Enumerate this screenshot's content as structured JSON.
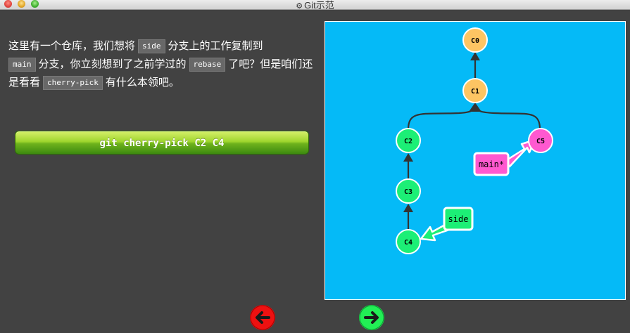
{
  "window": {
    "title": "Git示范",
    "icon": "gear-icon"
  },
  "description": {
    "p1": "这里有一个仓库，我们想将",
    "code_side": "side",
    "p2": "分支上的工作复制到",
    "code_main": "main",
    "p3": "分支，你立刻想到了之前学过的",
    "code_rebase": "rebase",
    "p4": "了吧？但是咱们还是看看",
    "code_cherry": "cherry-pick",
    "p5": "有什么本领吧。"
  },
  "command_button": {
    "label": "git cherry-pick C2 C4"
  },
  "graph": {
    "commits": [
      {
        "id": "C0",
        "color": "#fdc563"
      },
      {
        "id": "C1",
        "color": "#fdc563"
      },
      {
        "id": "C2",
        "color": "#1cef76"
      },
      {
        "id": "C3",
        "color": "#1cef76"
      },
      {
        "id": "C4",
        "color": "#1cef76"
      },
      {
        "id": "C5",
        "color": "#ff59d0"
      }
    ],
    "branches": [
      {
        "name": "main*",
        "target": "C5",
        "color": "#ff59d0"
      },
      {
        "name": "side",
        "target": "C4",
        "color": "#1cef76"
      }
    ],
    "background": "#05baf7"
  },
  "navigation": {
    "prev_icon": "arrow-left-icon",
    "next_icon": "arrow-right-icon"
  }
}
